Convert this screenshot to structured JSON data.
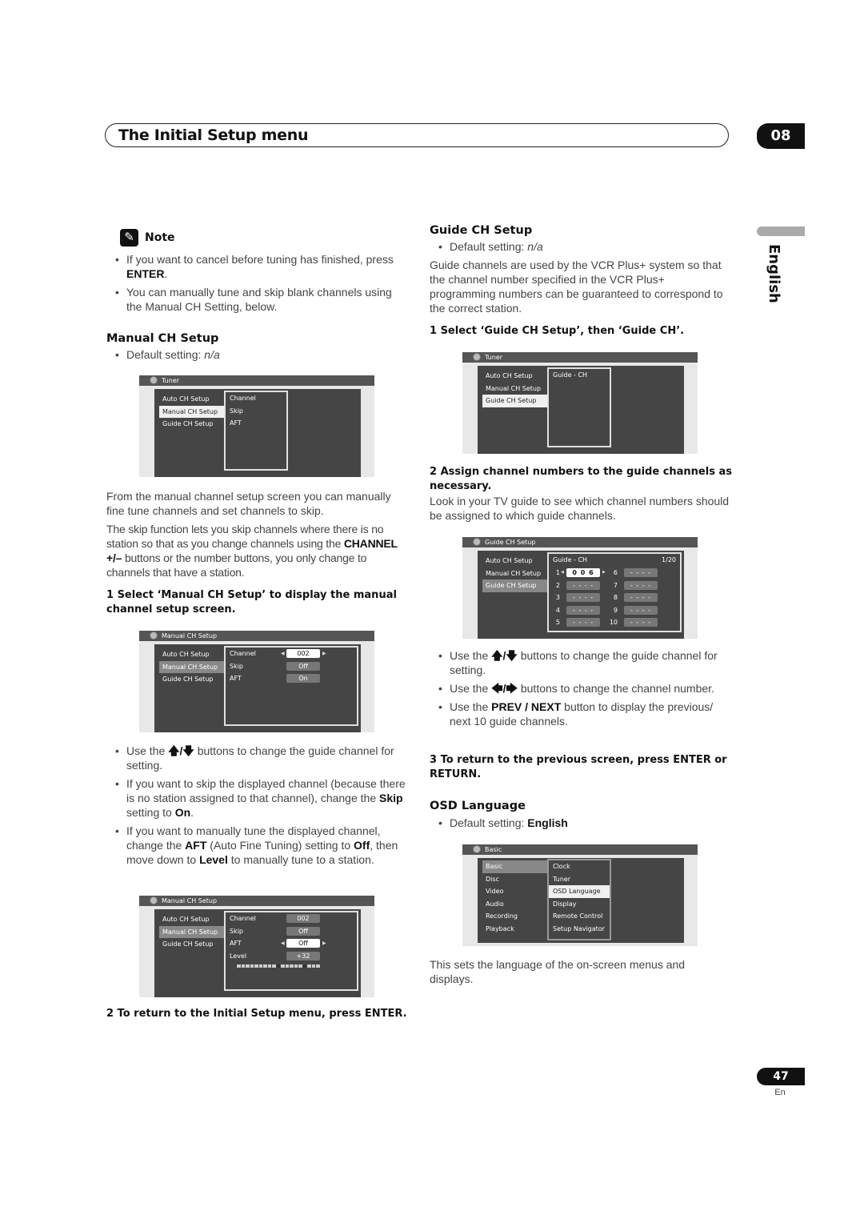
{
  "header": {
    "title": "The Initial Setup menu",
    "chapter": "08",
    "language_tab": "English"
  },
  "left": {
    "note": {
      "label": "Note",
      "bullets": [
        {
          "pre": "If you want to cancel before tuning has finished, press ",
          "bold": "ENTER",
          "post": "."
        },
        {
          "text": "You can manually tune and skip blank channels using the Manual CH Setting, below."
        }
      ]
    },
    "manual_ch": {
      "heading": "Manual CH Setup",
      "default_pre": "Default setting: ",
      "default_val": "n/a",
      "para1": "From the manual channel setup screen you can manually fine tune channels and set channels to skip.",
      "para2_pre": "The skip function lets you skip channels where there is no station so that as you change channels using the ",
      "para2_bold": "CHANNEL +/–",
      "para2_post": " buttons or the number buttons, you only change to channels that have a station.",
      "step1": "1   Select ‘Manual CH Setup’ to display the manual channel setup screen.",
      "bullets": {
        "b1_pre": "Use the ",
        "b1_icons": "🡅/🡇",
        "b1_post": " buttons to change the guide channel for setting.",
        "b2_pre": "If you want to skip the displayed channel (because there is no station assigned to that channel), change the ",
        "b2_bold1": "Skip",
        "b2_mid": " setting to ",
        "b2_bold2": "On",
        "b2_post": ".",
        "b3_pre": "If you want to manually tune the displayed channel, change the ",
        "b3_bold1": "AFT",
        "b3_mid1": " (Auto Fine Tuning) setting to ",
        "b3_bold2": "Off",
        "b3_mid2": ", then move down to ",
        "b3_bold3": "Level",
        "b3_post": " to manually tune to a station."
      },
      "step2": "2   To return to the Initial Setup menu, press ENTER."
    }
  },
  "right": {
    "guide_ch": {
      "heading": "Guide CH Setup",
      "default_pre": "Default setting: ",
      "default_val": "n/a",
      "para": "Guide channels are used by the VCR Plus+ system so that the channel number specified in the VCR Plus+ programming numbers can be guaranteed to correspond to the correct station.",
      "step1": "1   Select ‘Guide CH Setup’, then ‘Guide CH’.",
      "step2": "2   Assign channel numbers to the guide channels as necessary.",
      "step2_para": "Look in your TV guide to see which channel numbers should be assigned to which guide channels.",
      "b1_pre": "Use the ",
      "b1_icons": "🡅/🡇",
      "b1_post": " buttons to change the guide channel for setting.",
      "b2_pre": "Use the ",
      "b2_icons": "🡄/🡆",
      "b2_post": " buttons to change the channel number.",
      "b3_pre": "Use the ",
      "b3_bold": "PREV / NEXT",
      "b3_post": " button to display the previous/ next 10 guide channels.",
      "step3": "3   To return to the previous screen, press ENTER or RETURN."
    },
    "osd_lang": {
      "heading": "OSD Language",
      "default_pre": "Default setting: ",
      "default_val": "English",
      "para": "This sets the language of the on-screen menus and displays."
    }
  },
  "screens": {
    "tuner1": {
      "title": "Tuner",
      "left": [
        "Auto CH Setup",
        "Manual CH Setup",
        "Guide CH Setup"
      ],
      "sub": [
        "Channel",
        "Skip",
        "AFT"
      ]
    },
    "manual1": {
      "title": "Manual CH Setup",
      "left": [
        "Auto CH Setup",
        "Manual CH Setup",
        "Guide CH Setup"
      ],
      "rows": [
        {
          "label": "Channel",
          "value": "002"
        },
        {
          "label": "Skip",
          "value": "Off"
        },
        {
          "label": "AFT",
          "value": "On"
        }
      ]
    },
    "manual2": {
      "title": "Manual CH Setup",
      "left": [
        "Auto CH Setup",
        "Manual CH Setup",
        "Guide CH Setup"
      ],
      "rows": [
        {
          "label": "Channel",
          "value": "002"
        },
        {
          "label": "Skip",
          "value": "Off"
        },
        {
          "label": "AFT",
          "value": "Off"
        },
        {
          "label": "Level",
          "value": "+32"
        }
      ]
    },
    "tuner2": {
      "title": "Tuner",
      "left": [
        "Auto CH Setup",
        "Manual CH Setup",
        "Guide CH Setup"
      ],
      "sub": [
        "Guide - CH"
      ]
    },
    "guide": {
      "title": "Guide CH Setup",
      "left": [
        "Auto CH Setup",
        "Manual CH Setup",
        "Guide CH Setup"
      ],
      "head": "Guide - CH",
      "page": "1/20",
      "entries": [
        {
          "n": "1",
          "v": "0 0 6"
        },
        {
          "n": "2",
          "v": "- - - -"
        },
        {
          "n": "3",
          "v": "- - - -"
        },
        {
          "n": "4",
          "v": "- - - -"
        },
        {
          "n": "5",
          "v": "- - - -"
        },
        {
          "n": "6",
          "v": "- - - -"
        },
        {
          "n": "7",
          "v": "- - - -"
        },
        {
          "n": "8",
          "v": "- - - -"
        },
        {
          "n": "9",
          "v": "- - - -"
        },
        {
          "n": "10",
          "v": "- - - -"
        }
      ]
    },
    "basic": {
      "title": "Basic",
      "left": [
        "Basic",
        "Disc",
        "Video",
        "Audio",
        "Recording",
        "Playback"
      ],
      "sub": [
        "Clock",
        "Tuner",
        "OSD Language",
        "Display",
        "Remote Control",
        "Setup Navigator"
      ]
    }
  },
  "footer": {
    "page": "47",
    "lang": "En"
  }
}
